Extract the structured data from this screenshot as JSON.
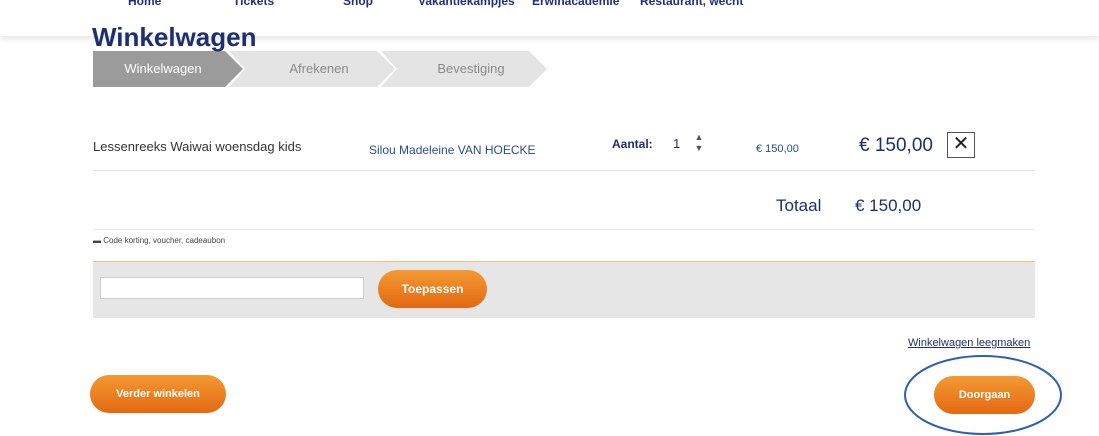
{
  "nav": {
    "items": [
      "Home",
      "Tickets",
      "Shop",
      "Vakantiekampjes",
      "Erwinacademie",
      "Restaurant, wecht"
    ]
  },
  "page": {
    "title": "Winkelwagen"
  },
  "steps": [
    {
      "label": "Winkelwagen",
      "active": true
    },
    {
      "label": "Afrekenen",
      "active": false
    },
    {
      "label": "Bevestiging",
      "active": false
    }
  ],
  "cart": {
    "items": [
      {
        "product": "Lessenreeks Waiwai woensdag kids",
        "participant": "Silou Madeleine VAN HOECKE",
        "quantity_label": "Aantal:",
        "quantity": "1",
        "unit_price": "€ 150,00",
        "line_total": "€ 150,00",
        "remove_symbol": "✕"
      }
    ],
    "total_label": "Totaal",
    "total_value": "€ 150,00"
  },
  "coupon": {
    "toggle_label": "Code korting, voucher, cadeaubon",
    "input_value": "",
    "apply_label": "Toepassen"
  },
  "actions": {
    "empty_cart_label": "Winkelwagen leegmaken",
    "continue_shopping_label": "Verder winkelen",
    "proceed_label": "Doorgaan"
  },
  "colors": {
    "brand_navy": "#1e2f6f",
    "accent_orange": "#e46811",
    "annotation_blue": "#2e5fb0"
  }
}
